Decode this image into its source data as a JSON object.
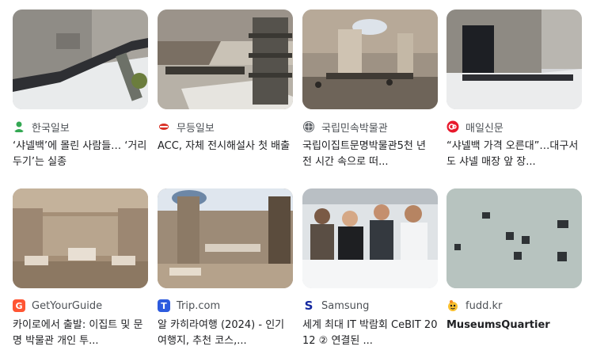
{
  "results": [
    {
      "source": "한국일보",
      "title": "‘샤넬백’에 몰린 사람들… ‘거리 두기’는 실종",
      "favicon": "hankook-person-icon",
      "image": "museum-queue-photo"
    },
    {
      "source": "무등일보",
      "title": "ACC, 자체 전시해설사 첫 배출",
      "favicon": "mudeung-logo-icon",
      "image": "museum-pagoda-photo"
    },
    {
      "source": "국립민속박물관",
      "title": "국립이집트문명박물관5천 년 전 시간 속으로 떠...",
      "favicon": "globe-icon",
      "image": "museum-hall-photo"
    },
    {
      "source": "매일신문",
      "title": "“샤넬백 가격 오른대”…대구서도 샤넬 매장 앞 장...",
      "favicon": "maeil-logo-icon",
      "image": "store-queue-photo"
    },
    {
      "source": "GetYourGuide",
      "title": "카이로에서 출발: 이집트 및 문명 박물관 개인 투...",
      "favicon": "getyourguide-g-icon",
      "image": "museum-gallery-photo"
    },
    {
      "source": "Trip.com",
      "title": "알 카히라여행 (2024) - 인기 여행지, 추천 코스,...",
      "favicon": "tripcom-t-icon",
      "image": "museum-atrium-photo"
    },
    {
      "source": "Samsung",
      "title": "세계 최대 IT 박람회 CeBIT 2012 ② 연결된 ...",
      "favicon": "samsung-s-icon",
      "image": "expo-visitors-photo"
    },
    {
      "source": "fudd.kr",
      "title": "MuseumsQuartier",
      "favicon": "fudd-emoji-icon",
      "image": "aerial-square-photo"
    }
  ],
  "colors": {
    "source_text": "#4d5156",
    "title_text": "#202124",
    "hankook_green": "#34a853",
    "mudeung_red": "#d93025",
    "maeil_red": "#e8192c",
    "getyourguide_orange": "#ff5533",
    "tripcom_blue": "#2d5bde",
    "samsung_navy": "#1428a0"
  }
}
